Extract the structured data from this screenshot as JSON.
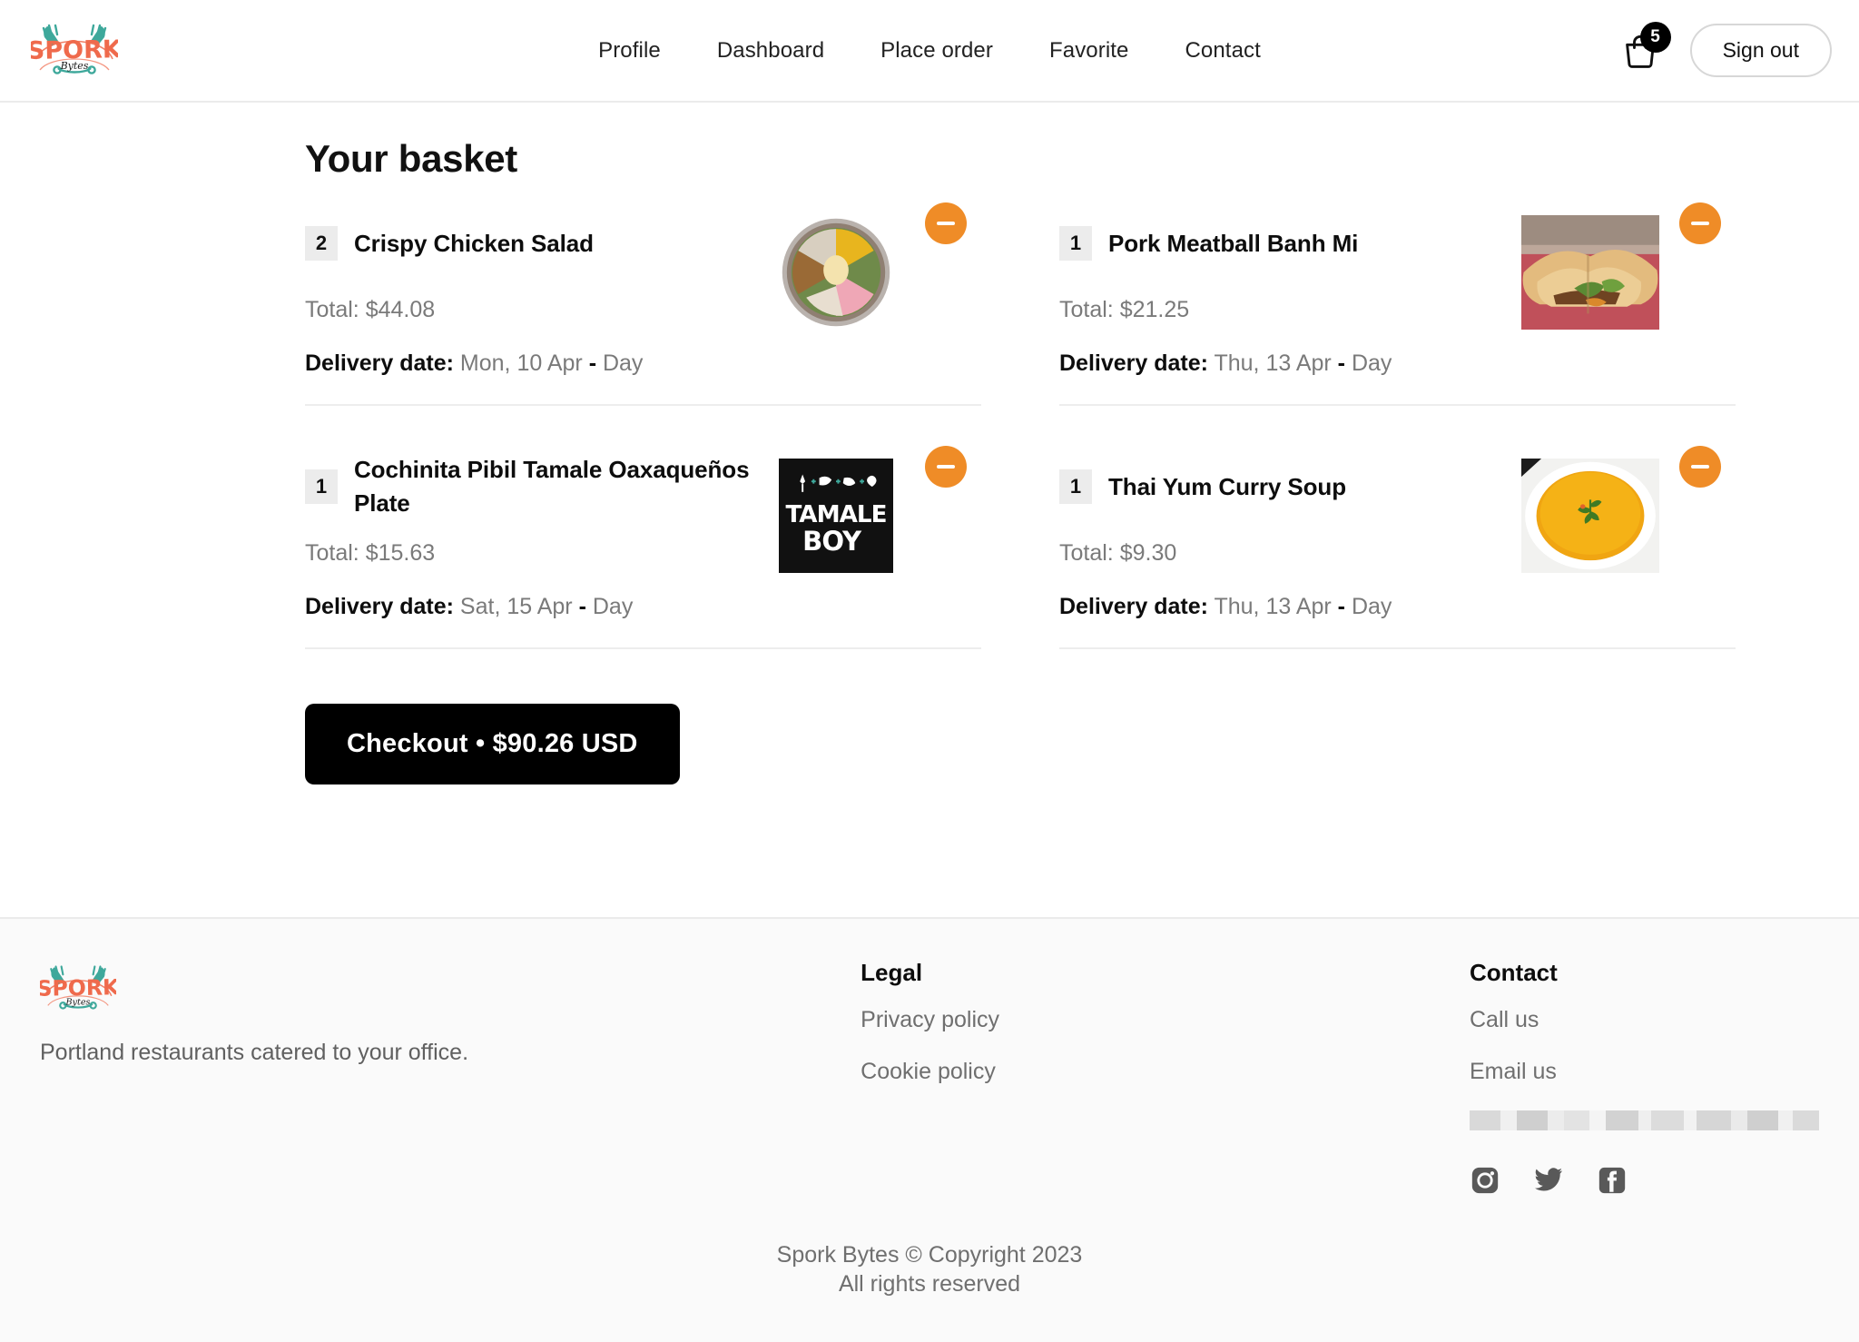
{
  "brand": {
    "name": "SPORK",
    "sub": "Bytes",
    "colors": {
      "spork_text": "#ef6a4c",
      "spork_utensils": "#3ea89b",
      "accent_orange": "#ef8c27",
      "black": "#000000"
    }
  },
  "header": {
    "nav": [
      {
        "label": "Profile",
        "name": "nav-profile"
      },
      {
        "label": "Dashboard",
        "name": "nav-dashboard"
      },
      {
        "label": "Place order",
        "name": "nav-place-order"
      },
      {
        "label": "Favorite",
        "name": "nav-favorite"
      },
      {
        "label": "Contact",
        "name": "nav-contact"
      }
    ],
    "bag_icon": "shopping-bag-icon",
    "bag_count": "5",
    "signout_label": "Sign out"
  },
  "main": {
    "title": "Your basket",
    "total_label": "Total:",
    "delivery_label": "Delivery date:",
    "dash": "-",
    "checkout_label": "Checkout • $90.26 USD",
    "items": [
      {
        "qty": "2",
        "name": "Crispy Chicken Salad",
        "total": "$44.08",
        "delivery_date": "Mon, 10 Apr",
        "delivery_slot": "Day",
        "thumb": "crispy-chicken-salad-photo",
        "remove_icon": "minus-icon"
      },
      {
        "qty": "1",
        "name": "Pork Meatball Banh Mi",
        "total": "$21.25",
        "delivery_date": "Thu, 13 Apr",
        "delivery_slot": "Day",
        "thumb": "pork-meatball-banh-mi-photo",
        "remove_icon": "minus-icon"
      },
      {
        "qty": "1",
        "name": "Cochinita Pibil Tamale Oaxaqueños Plate",
        "total": "$15.63",
        "delivery_date": "Sat, 15 Apr",
        "delivery_slot": "Day",
        "thumb": "tamale-boy-logo",
        "remove_icon": "minus-icon"
      },
      {
        "qty": "1",
        "name": "Thai Yum Curry Soup",
        "total": "$9.30",
        "delivery_date": "Thu, 13 Apr",
        "delivery_slot": "Day",
        "thumb": "thai-yum-curry-soup-photo",
        "remove_icon": "minus-icon"
      }
    ]
  },
  "footer": {
    "tagline": "Portland restaurants catered to your office.",
    "legal": {
      "heading": "Legal",
      "links": [
        {
          "label": "Privacy policy"
        },
        {
          "label": "Cookie policy"
        }
      ]
    },
    "contact": {
      "heading": "Contact",
      "links": [
        {
          "label": "Call us"
        },
        {
          "label": "Email us"
        }
      ],
      "redacted_email": ""
    },
    "socials": [
      {
        "name": "instagram-icon"
      },
      {
        "name": "twitter-icon"
      },
      {
        "name": "facebook-icon"
      }
    ],
    "copyright_line1": "Spork Bytes © Copyright 2023",
    "copyright_line2": "All rights reserved"
  }
}
